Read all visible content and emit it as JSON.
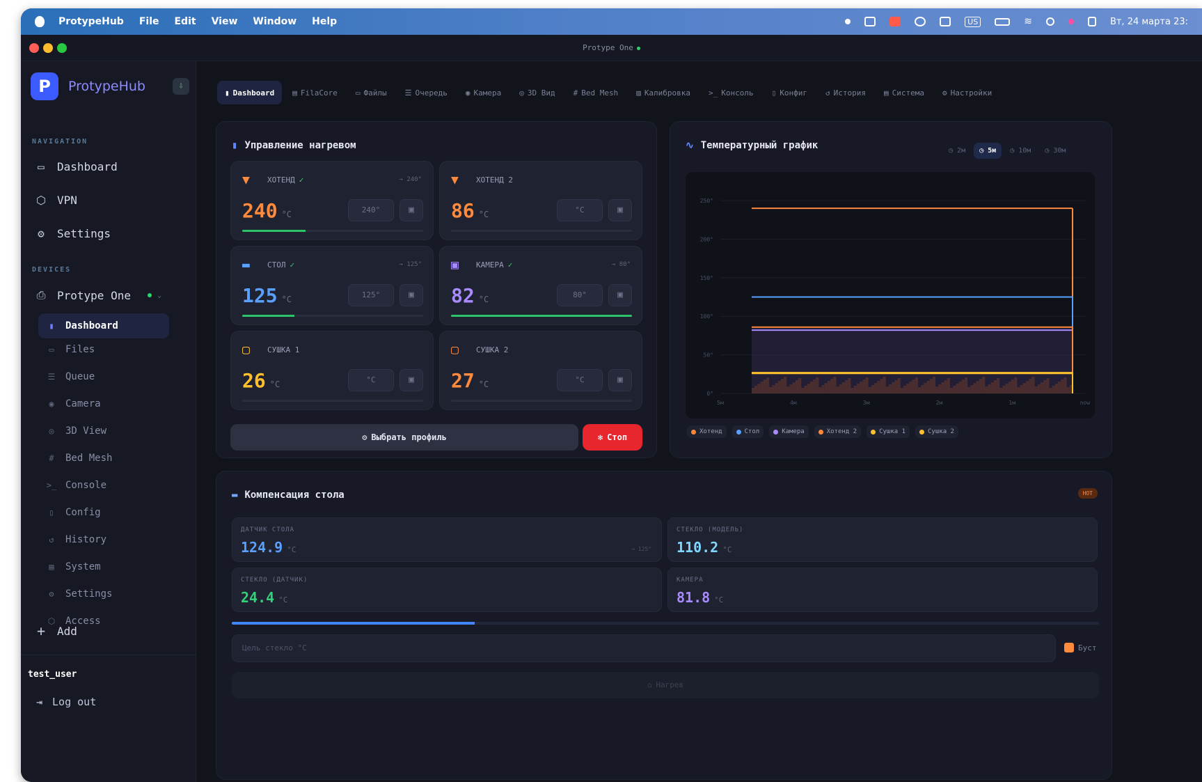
{
  "menubar": {
    "app": "ProtypeHub",
    "menus": [
      "File",
      "Edit",
      "View",
      "Window",
      "Help"
    ],
    "clock": "Вт, 24 марта 23:",
    "input_lang": "US"
  },
  "window": {
    "title": "Protype One"
  },
  "brand": {
    "name": "ProtypeHub",
    "logo_letter": "P"
  },
  "sidebar": {
    "nav_label": "NAVIGATION",
    "nav": [
      {
        "label": "Dashboard",
        "icon": "monitor-icon"
      },
      {
        "label": "VPN",
        "icon": "shield-icon"
      },
      {
        "label": "Settings",
        "icon": "gear-icon"
      }
    ],
    "devices_label": "DEVICES",
    "device": {
      "label": "Protype One",
      "status_color": "#2fd36a"
    },
    "sub": [
      {
        "label": "Dashboard",
        "icon": "thermometer-icon",
        "active": true
      },
      {
        "label": "Files",
        "icon": "folder-icon"
      },
      {
        "label": "Queue",
        "icon": "list-icon"
      },
      {
        "label": "Camera",
        "icon": "camera-icon"
      },
      {
        "label": "3D View",
        "icon": "eye-icon"
      },
      {
        "label": "Bed Mesh",
        "icon": "grid-icon"
      },
      {
        "label": "Console",
        "icon": "terminal-icon"
      },
      {
        "label": "Config",
        "icon": "file-icon"
      },
      {
        "label": "History",
        "icon": "history-icon"
      },
      {
        "label": "System",
        "icon": "server-icon"
      },
      {
        "label": "Settings",
        "icon": "gear-icon"
      },
      {
        "label": "Access",
        "icon": "shield-icon"
      }
    ],
    "add_label": "Add",
    "user": "test_user",
    "logout": "Log out"
  },
  "tabs": [
    {
      "label": "Dashboard",
      "icon": "thermometer-icon",
      "active": true
    },
    {
      "label": "FilaCore",
      "icon": "box-icon"
    },
    {
      "label": "Файлы",
      "icon": "folder-icon"
    },
    {
      "label": "Очередь",
      "icon": "list-icon"
    },
    {
      "label": "Камера",
      "icon": "camera-icon"
    },
    {
      "label": "3D Вид",
      "icon": "eye-icon"
    },
    {
      "label": "Bed Mesh",
      "icon": "grid-icon"
    },
    {
      "label": "Калибровка",
      "icon": "chart-icon"
    },
    {
      "label": "Консоль",
      "icon": "terminal-icon"
    },
    {
      "label": "Конфиг",
      "icon": "file-icon"
    },
    {
      "label": "История",
      "icon": "history-icon"
    },
    {
      "label": "Система",
      "icon": "server-icon"
    },
    {
      "label": "Настройки",
      "icon": "gear-icon"
    }
  ],
  "heating": {
    "title": "Управление нагревом",
    "cards": [
      {
        "label": "ХОТЕНД",
        "ok": true,
        "target": "→ 240°",
        "value": "240",
        "unit": "°C",
        "input": "240°",
        "color": "#ff8a3c",
        "progress": 0.35,
        "icon": "nozzle-icon"
      },
      {
        "label": "ХОТЕНД 2",
        "ok": false,
        "target": "",
        "value": "86",
        "unit": "°C",
        "input": "°C",
        "color": "#ff8a3c",
        "progress": 0,
        "icon": "nozzle-icon"
      },
      {
        "label": "СТОЛ",
        "ok": true,
        "target": "→ 125°",
        "value": "125",
        "unit": "°C",
        "input": "125°",
        "color": "#5aa0ff",
        "progress": 0.29,
        "icon": "bed-icon"
      },
      {
        "label": "КАМЕРА",
        "ok": true,
        "target": "→ 80°",
        "value": "82",
        "unit": "°C",
        "input": "80°",
        "color": "#a88bff",
        "progress": 1.0,
        "icon": "chamber-icon"
      },
      {
        "label": "СУШКА 1",
        "ok": false,
        "target": "",
        "value": "26",
        "unit": "°C",
        "input": "°C",
        "color": "#ffc02e",
        "progress": 0,
        "icon": "dryer-icon"
      },
      {
        "label": "СУШКА 2",
        "ok": false,
        "target": "",
        "value": "27",
        "unit": "°C",
        "input": "°C",
        "color": "#ff8a3c",
        "progress": 0,
        "icon": "dryer-icon"
      }
    ],
    "profile_btn": "Выбрать профиль",
    "stop_btn": "Стоп"
  },
  "graph": {
    "title": "Температурный график",
    "ranges": [
      {
        "label": "2м",
        "active": false
      },
      {
        "label": "5м",
        "active": true
      },
      {
        "label": "10м",
        "active": false
      },
      {
        "label": "30м",
        "active": false
      }
    ]
  },
  "chart_data": {
    "type": "line",
    "ylim": [
      0,
      260
    ],
    "yticks": [
      "250°",
      "200°",
      "150°",
      "100°",
      "50°",
      "0°"
    ],
    "xticks": [
      "5м",
      "4м",
      "3м",
      "2м",
      "1м",
      "now"
    ],
    "series": [
      {
        "name": "Хотенд",
        "color": "#ff8a3c",
        "value": 240
      },
      {
        "name": "Стол",
        "color": "#5aa0ff",
        "value": 125
      },
      {
        "name": "Камера",
        "color": "#a88bff",
        "value": 82
      },
      {
        "name": "Хотенд 2",
        "color": "#ff8a3c",
        "value": 86
      },
      {
        "name": "Сушка 1",
        "color": "#ffc02e",
        "value": 26
      },
      {
        "name": "Сушка 2",
        "color": "#ffc02e",
        "value": 27
      }
    ]
  },
  "bed": {
    "title": "Компенсация стола",
    "badge": "HOT",
    "cards": [
      {
        "label": "ДАТЧИК СТОЛА",
        "value": "124.9",
        "unit": "°C",
        "target": "→ 125°",
        "color": "#5aa0ff"
      },
      {
        "label": "СТЕКЛО (МОДЕЛЬ)",
        "value": "110.2",
        "unit": "°C",
        "target": "",
        "color": "#7fd7ff"
      },
      {
        "label": "СТЕКЛО (ДАТЧИК)",
        "value": "24.4",
        "unit": "°C",
        "target": "",
        "color": "#33d17a"
      },
      {
        "label": "КАМЕРА",
        "value": "81.8",
        "unit": "°C",
        "target": "",
        "color": "#a88bff"
      }
    ],
    "progress": 0.28,
    "input_placeholder": "Цель стекло °C",
    "boost_label": "Буст",
    "heat_btn": "Нагрев"
  }
}
